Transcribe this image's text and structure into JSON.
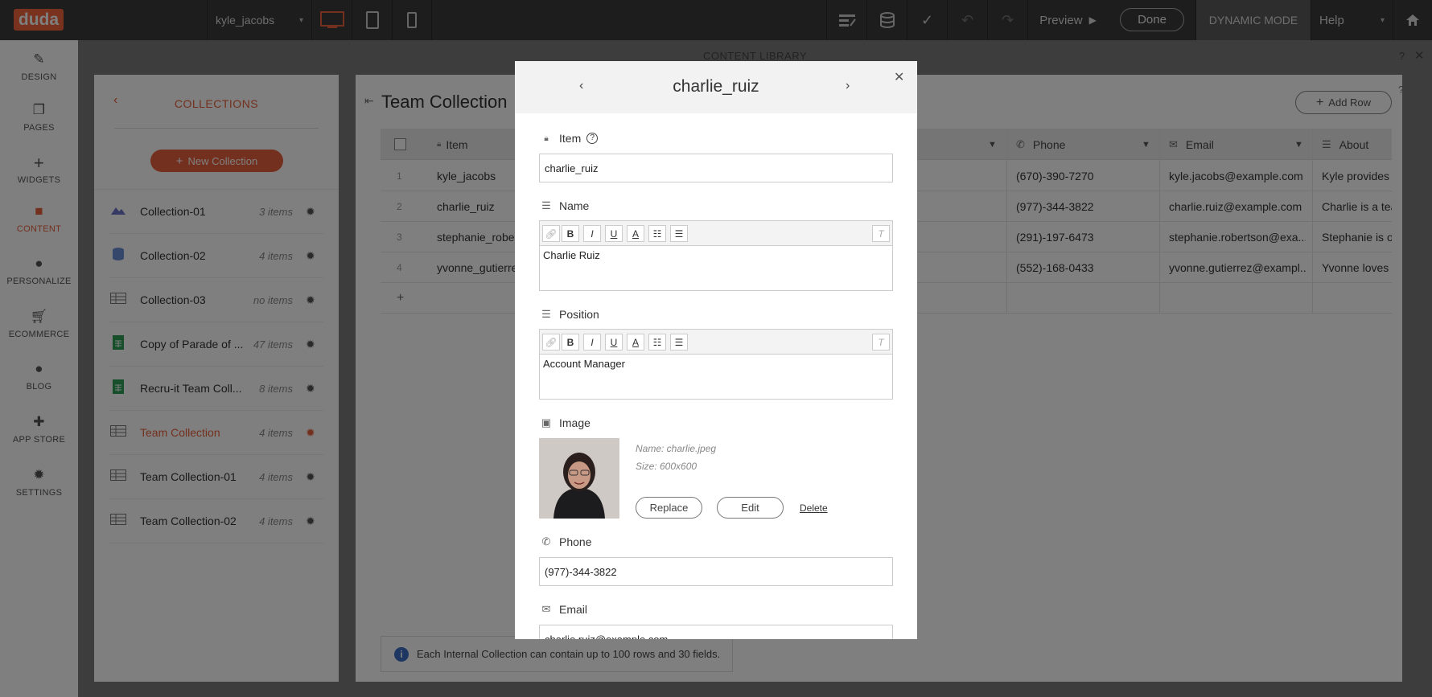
{
  "topbar": {
    "logo": "duda",
    "page_select": "kyle_jacobs",
    "preview": "Preview",
    "done": "Done",
    "dynamic_mode": "DYNAMIC MODE",
    "help": "Help"
  },
  "leftnav": {
    "items": [
      {
        "label": "DESIGN",
        "icon": "brush-icon"
      },
      {
        "label": "PAGES",
        "icon": "pages-icon"
      },
      {
        "label": "WIDGETS",
        "icon": "plus-icon"
      },
      {
        "label": "CONTENT",
        "icon": "folder-icon"
      },
      {
        "label": "PERSONALIZE",
        "icon": "person-icon"
      },
      {
        "label": "ECOMMERCE",
        "icon": "cart-icon"
      },
      {
        "label": "BLOG",
        "icon": "chat-icon"
      },
      {
        "label": "APP STORE",
        "icon": "puzzle-icon"
      },
      {
        "label": "SETTINGS",
        "icon": "gear-icon"
      }
    ],
    "active": "CONTENT"
  },
  "library": {
    "title": "CONTENT LIBRARY",
    "collections_title": "COLLECTIONS",
    "new_collection": "New Collection",
    "collections": [
      {
        "name": "Collection-01",
        "count": "3 items"
      },
      {
        "name": "Collection-02",
        "count": "4 items"
      },
      {
        "name": "Collection-03",
        "count": "no items"
      },
      {
        "name": "Copy of Parade of ...",
        "count": "47 items"
      },
      {
        "name": "Recru-it Team Coll...",
        "count": "8 items"
      },
      {
        "name": "Team Collection",
        "count": "4 items"
      },
      {
        "name": "Team Collection-01",
        "count": "4 items"
      },
      {
        "name": "Team Collection-02",
        "count": "4 items"
      }
    ],
    "selected": "Team Collection"
  },
  "table": {
    "title": "Team Collection",
    "add_row": "Add Row",
    "columns": [
      "Item",
      "Phone",
      "Email",
      "About"
    ],
    "rows": [
      {
        "num": "1",
        "item": "kyle_jacobs",
        "phone": "(670)-390-7270",
        "email": "kyle.jacobs@example.com",
        "about": "Kyle provides o"
      },
      {
        "num": "2",
        "item": "charlie_ruiz",
        "phone": "(977)-344-3822",
        "email": "charlie.ruiz@example.com",
        "about": "Charlie is a tea"
      },
      {
        "num": "3",
        "item": "stephanie_rober",
        "phone": "(291)-197-6473",
        "email": "stephanie.robertson@exa...",
        "about": "Stephanie is ou"
      },
      {
        "num": "4",
        "item": "yvonne_gutierre",
        "phone": "(552)-168-0433",
        "email": "yvonne.gutierrez@exampl...",
        "about": "Yvonne loves b"
      }
    ],
    "add_symbol": "+",
    "info": "Each Internal Collection can contain up to 100 rows and 30 fields."
  },
  "modal": {
    "title": "charlie_ruiz",
    "item_label": "Item",
    "item_value": "charlie_ruiz",
    "name_label": "Name",
    "name_value": "Charlie Ruiz",
    "position_label": "Position",
    "position_value": "Account Manager",
    "image_label": "Image",
    "image_name": "Name: charlie.jpeg",
    "image_size": "Size: 600x600",
    "replace": "Replace",
    "edit": "Edit",
    "delete": "Delete",
    "phone_label": "Phone",
    "phone_value": "(977)-344-3822",
    "email_label": "Email",
    "email_value": "charlie.ruiz@example.com"
  },
  "colors": {
    "accent": "#e8603c",
    "topbar": "#3a3a3a"
  }
}
